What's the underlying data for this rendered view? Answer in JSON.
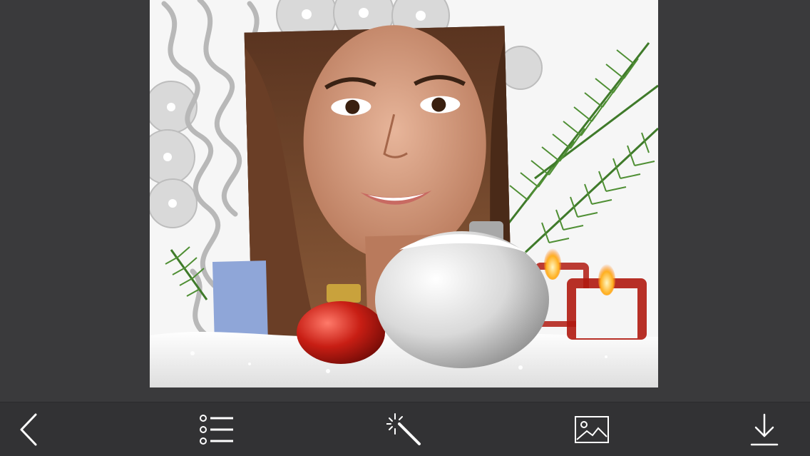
{
  "app": {
    "screen": "photo-frame-editor"
  },
  "frame": {
    "theme": "christmas-snow-ornaments",
    "background_color": "#f4f4f4",
    "snow_color": "#f2f2f2",
    "ornament_red": "#c81e14",
    "ornament_silver": "#e6e6e6",
    "pine_color": "#3f7a2a",
    "candle_flame": "#ffb020"
  },
  "toolbar": {
    "background_color": "#323234",
    "icon_color": "#ffffff",
    "buttons": [
      {
        "id": "back",
        "icon": "chevron-left-icon"
      },
      {
        "id": "frames",
        "icon": "list-icon"
      },
      {
        "id": "effects",
        "icon": "magic-wand-icon"
      },
      {
        "id": "gallery",
        "icon": "image-icon"
      },
      {
        "id": "save",
        "icon": "download-icon"
      }
    ]
  }
}
